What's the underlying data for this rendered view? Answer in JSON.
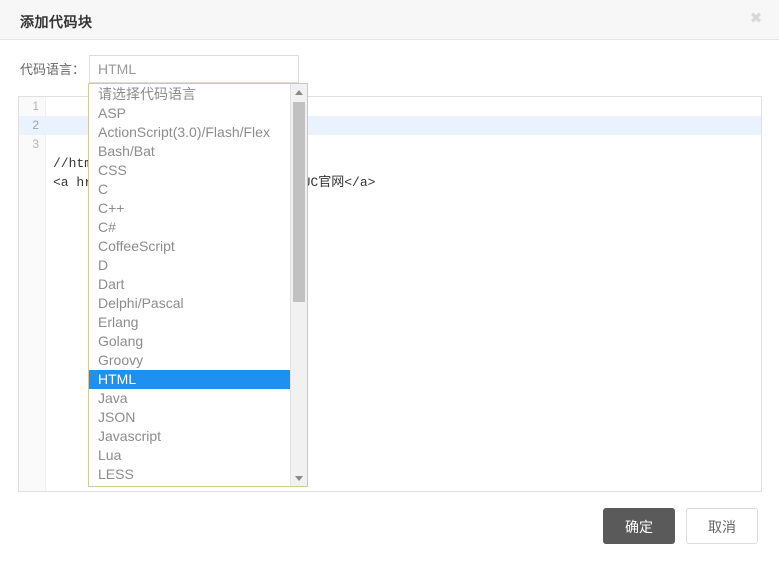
{
  "dialog": {
    "title": "添加代码块",
    "close_icon": "✖"
  },
  "form": {
    "label": "代码语言：",
    "input_value": "HTML",
    "input_placeholder": "请选择代码语言"
  },
  "dropdown": {
    "selected": "HTML",
    "items": [
      "请选择代码语言",
      "ASP",
      "ActionScript(3.0)/Flash/Flex",
      "Bash/Bat",
      "CSS",
      "C",
      "C++",
      "C#",
      "CoffeeScript",
      "D",
      "Dart",
      "Delphi/Pascal",
      "Erlang",
      "Golang",
      "Groovy",
      "HTML",
      "Java",
      "JSON",
      "Javascript",
      "Lua",
      "LESS"
    ],
    "scroll_up_icon": "scroll-up-arrow",
    "scroll_down_icon": "scroll-down-arrow"
  },
  "editor": {
    "lines": [
      {
        "number": "1",
        "text": "//html",
        "active": false
      },
      {
        "number": "2",
        "text": "<a href=\"http://www.jiuc.com\">JIUC官网</a>",
        "active": true
      },
      {
        "number": "3",
        "text": "",
        "active": false
      }
    ]
  },
  "footer": {
    "confirm_label": "确定",
    "cancel_label": "取消"
  },
  "colors": {
    "accent": "#1e90f0",
    "header_bg": "#f7f7f7",
    "active_line": "#eaf2fd",
    "primary_button": "#5a5a5a",
    "dropdown_border": "#d7c89b"
  }
}
